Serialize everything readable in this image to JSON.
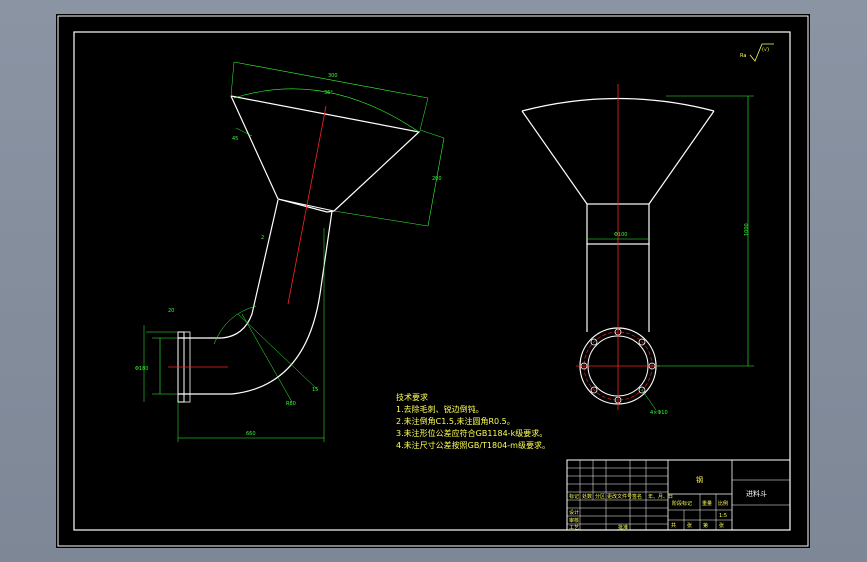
{
  "drawing": {
    "tech_requirements": {
      "title": "技术要求",
      "items": [
        "1.去除毛刺、锐边倒钝。",
        "2.未注倒角C1.5,未注圆角R0.5。",
        "3.未注形位公差应符合GB1184-k级要求。",
        "4.未注尺寸公差按照GB/T1804-m级要求。"
      ]
    },
    "dimensions": {
      "funnel_width": "300",
      "funnel_angle": "36°",
      "funnel_height": "200",
      "chamfer": "45",
      "pipe_note": "2",
      "bend_radius": "R80",
      "flange_dia": "Φ180",
      "flange_offset": "15",
      "flange_height": "20",
      "overall_length": "660",
      "right_height": "1000",
      "neck_width": "Φ100",
      "hole_note": "4×Φ10"
    },
    "surface_finish": "(√)",
    "title_block": {
      "material": "钢",
      "part_name": "进料斗",
      "scale": "1:5",
      "row_labels": [
        "标记",
        "设计",
        "审核",
        "工艺"
      ],
      "col_labels": [
        "处数",
        "分区",
        "更改文件号",
        "签名",
        "年、月、日"
      ],
      "stage_labels": [
        "阶段标记",
        "重量",
        "比例"
      ],
      "sheet_labels": [
        "共",
        "张",
        "第",
        "张"
      ],
      "approve": "批准"
    }
  }
}
